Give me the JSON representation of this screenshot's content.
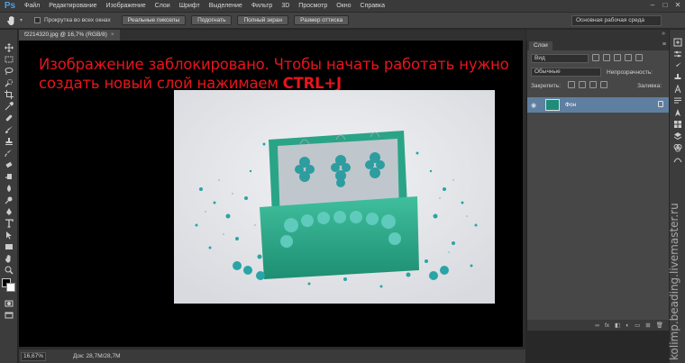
{
  "app": {
    "logo": "Ps",
    "menu": [
      "Файл",
      "Редактирование",
      "Изображение",
      "Слои",
      "Шрифт",
      "Выделение",
      "Фильтр",
      "3D",
      "Просмотр",
      "Окно",
      "Справка"
    ],
    "window_controls": [
      "–",
      "□",
      "✕"
    ]
  },
  "options_bar": {
    "scroll_all_label": "Прокрутка во всех окнах",
    "buttons": [
      "Реальные пикселы",
      "Подогнать",
      "Полный экран",
      "Размер оттиска"
    ],
    "workspace": "Основная рабочая среда"
  },
  "document": {
    "tab_title": "f2214320.jpg @ 16,7% (RGB/8)",
    "tab_close": "×",
    "overlay_line1": "Изображение заблокировано. Чтобы начать работать нужно",
    "overlay_line2": "создать новый слой нажимаем ",
    "overlay_shortcut": "CTRL+J",
    "zoom": "16,67%",
    "doc_info": "Док: 28,7M/28,7M"
  },
  "layers_panel": {
    "tab": "Слои",
    "kind_filter": "Вид",
    "blend_mode": "Обычные",
    "opacity_label": "Непрозрачность:",
    "lock_label": "Закрепить:",
    "fill_label": "Заливка:",
    "layer_name": "Фон",
    "footer_fx": "fx"
  },
  "watermark": "kolimp.beading.livemaster.ru",
  "colors": {
    "overlay_text": "#e8141c",
    "selected_layer": "#5f7fa1",
    "ps_logo": "#4aa0e6"
  }
}
